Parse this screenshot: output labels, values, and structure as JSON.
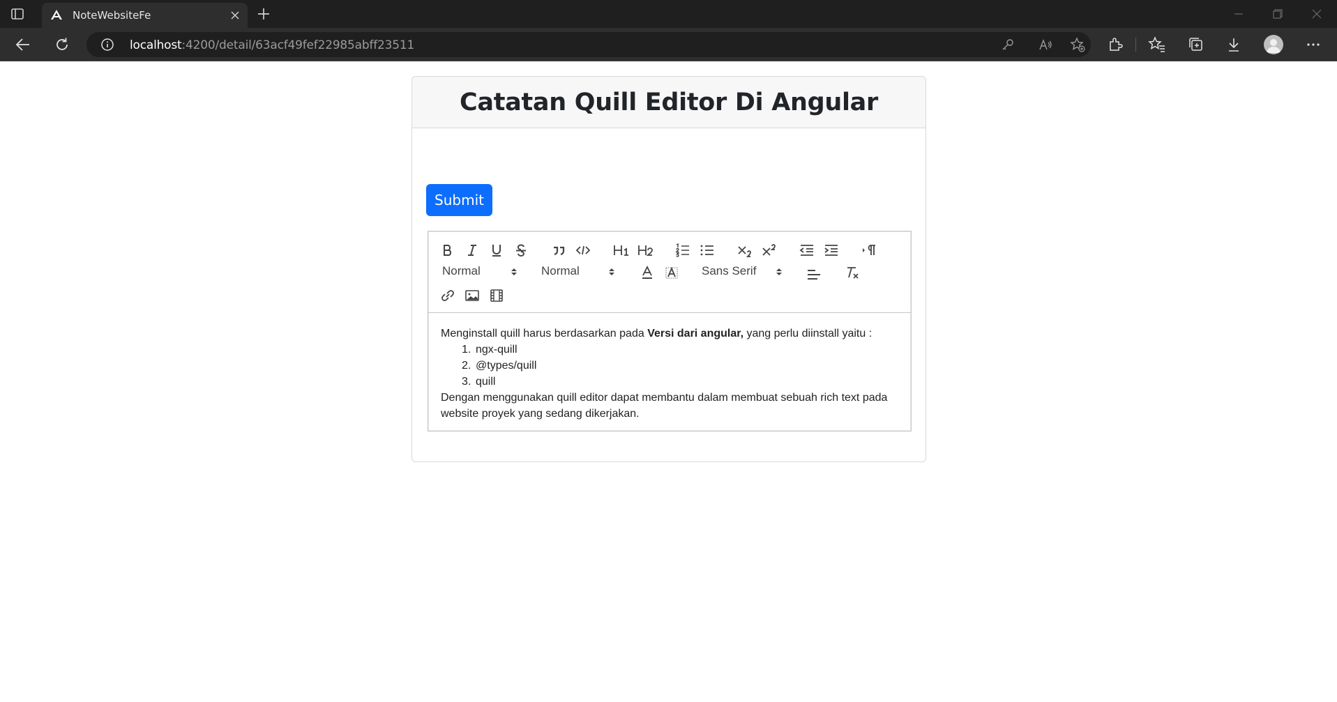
{
  "browser": {
    "tab_title": "NoteWebsiteFe",
    "url_host": "localhost",
    "url_rest": ":4200/detail/63acf49fef22985abff23511"
  },
  "page": {
    "title": "Catatan Quill Editor Di Angular",
    "submit_label": "Submit"
  },
  "editor_toolbar": {
    "header_select": "Normal",
    "size_select": "Normal",
    "font_select": "Sans Serif"
  },
  "editor_content": {
    "intro_start": "Menginstall quill harus berdasarkan pada ",
    "intro_bold": "Versi dari angular,",
    "intro_end": " yang perlu diinstall yaitu :",
    "list": [
      {
        "num": "1.",
        "text": "ngx-quill"
      },
      {
        "num": "2.",
        "text": "@types/quill"
      },
      {
        "num": "3.",
        "text": "quill"
      }
    ],
    "closing": "Dengan menggunakan quill editor dapat membantu dalam membuat sebuah rich text pada website proyek yang sedang dikerjakan."
  }
}
